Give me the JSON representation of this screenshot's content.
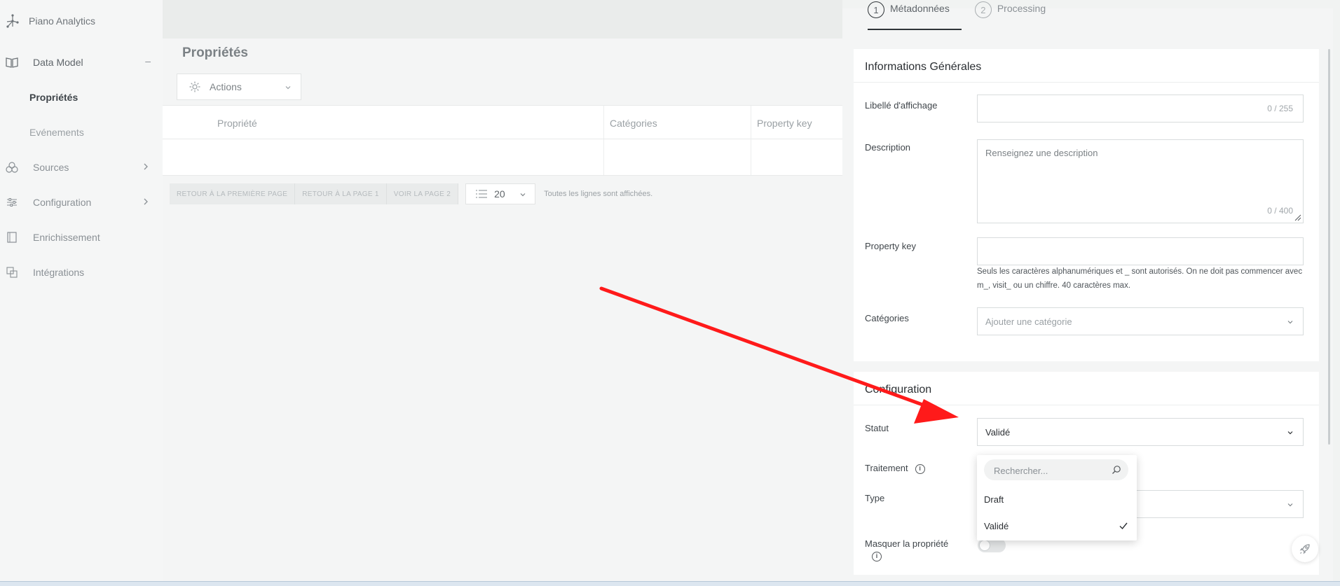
{
  "app": {
    "name": "Piano Analytics"
  },
  "sidebar": {
    "sections": [
      {
        "label": "Data Model",
        "icon": "book-icon",
        "expanded": true
      },
      {
        "label": "Sources",
        "icon": "sources-icon"
      },
      {
        "label": "Configuration",
        "icon": "sliders-icon"
      },
      {
        "label": "Enrichissement",
        "icon": "document-icon"
      },
      {
        "label": "Intégrations",
        "icon": "integrations-icon"
      }
    ],
    "sub_items": [
      {
        "label": "Propriétés",
        "active": true
      },
      {
        "label": "Evénements"
      }
    ],
    "collapse_symbol": "–"
  },
  "main": {
    "title": "Propriétés",
    "actions_label": "Actions",
    "table": {
      "columns": [
        "Propriété",
        "Catégories",
        "Property key"
      ]
    },
    "pager": {
      "first_label": "RETOUR À LA PREMIÈRE PAGE",
      "prev_label": "RETOUR À LA PAGE 1",
      "next_label": "VOIR LA PAGE 2",
      "per_page": "20",
      "info": "Toutes les lignes sont affichées."
    }
  },
  "panel": {
    "steps": [
      {
        "number": "1",
        "label": "Métadonnées",
        "active": true
      },
      {
        "number": "2",
        "label": "Processing"
      }
    ],
    "general": {
      "title": "Informations Générales",
      "display_label": "Libellé d'affichage",
      "display_counter": "0 / 255",
      "description_label": "Description",
      "description_placeholder": "Renseignez une description",
      "description_counter": "0 / 400",
      "property_key_label": "Property key",
      "property_key_hint": "Seuls les caractères alphanumériques et _ sont autorisés. On ne doit pas commencer avec m_, visit_ ou un chiffre. 40 caractères max.",
      "categories_label": "Catégories",
      "categories_placeholder": "Ajouter une catégorie"
    },
    "configuration": {
      "title": "Configuration",
      "status_label": "Statut",
      "status_value": "Validé",
      "treatment_label": "Traitement",
      "type_label": "Type",
      "hide_label": "Masquer la propriété",
      "hide_value": false
    },
    "status_dropdown": {
      "search_placeholder": "Rechercher...",
      "options": [
        {
          "label": "Draft",
          "selected": false
        },
        {
          "label": "Validé",
          "selected": true
        }
      ]
    }
  },
  "annotation": {
    "arrow_color": "#ff1a1a"
  }
}
